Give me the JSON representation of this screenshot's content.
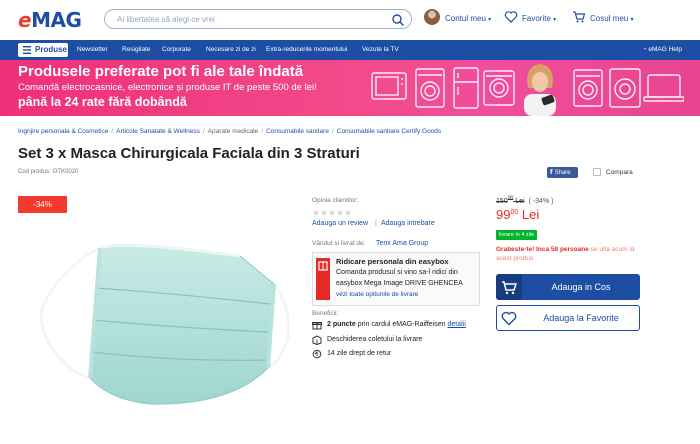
{
  "header": {
    "logo": {
      "e": "e",
      "mag": "MAG"
    },
    "search_placeholder": "Ai libertatea să alegi ce vrei",
    "account_label": "Contul meu",
    "favorites_label": "Favorite",
    "cart_label": "Cosul meu",
    "dropdown_glyph": "▾"
  },
  "nav": {
    "produse_label": "Produse",
    "items": [
      "Newsletter",
      "Resigilate",
      "Corporate",
      "Necesare zi de zi",
      "Extra-reducerile momentului",
      "Vezute la TV"
    ],
    "help_label": "eMAG Help"
  },
  "banner": {
    "line1": "Produsele preferate pot fi ale tale îndată",
    "line2": "Comandă electrocasnice, electronice și produse IT de peste 500 de lei!",
    "line3": "până la 24 rate fără dobândă"
  },
  "breadcrumb": [
    {
      "label": "Ingrijire personala & Cosmetice",
      "link": true
    },
    {
      "label": "Articole Sanatate & Wellness",
      "link": true
    },
    {
      "label": "Aparate medicale",
      "link": false
    },
    {
      "label": "Consumabile sanitare",
      "link": true
    },
    {
      "label": "Consumabile sanitare Certify Goods",
      "link": true
    }
  ],
  "breadcrumb_sep": "/",
  "product": {
    "title": "Set 3 x Masca Chirurgicala Faciala din 3 Straturi",
    "code_label": "Cod produs:",
    "code_value": "OTK0020",
    "discount_badge": "-34%",
    "share_label": "Share",
    "share_icon": "f",
    "compare_label": "Compara"
  },
  "reviews": {
    "opinion_label": "Opinia clientilor:",
    "rating": 0,
    "max_rating": 5,
    "add_review": "Adauga un review",
    "sep": "|",
    "add_question": "Adauga intrebare"
  },
  "seller": {
    "label": "Vândut și livrat de:",
    "name": "Tenx Ama Group"
  },
  "easybox": {
    "title": "Ridicare personala din easybox",
    "line1": "Comanda produsul si vino sa-l ridici din",
    "line2": "easybox Mega Image DRIVE GHENCEA",
    "link": "vezi toate optiunile de livrare"
  },
  "benefits": {
    "label": "Beneficii:",
    "points_bold": "2 puncte",
    "points_text": " prin cardul eMAG-Raiffeisen ",
    "points_link": "detalii",
    "open_package": "Deschiderea coletului la livrare",
    "return": "14 zile drept de retur"
  },
  "price": {
    "old": "150",
    "old_sup": "00",
    "old_currency": "Lei",
    "discount": "( -34% )",
    "new": "99",
    "new_sup": "00",
    "new_currency": "Lei",
    "stock": "livrare in 4 zile",
    "hurry_bold": "Grabeste-te! Inca 58 persoane",
    "hurry_text": " se uita acum la acest produs"
  },
  "buttons": {
    "add_to_cart": "Adauga in Cos",
    "add_to_fav": "Adauga la Favorite"
  },
  "colors": {
    "brand_blue": "#1d4ea3",
    "brand_red": "#f2392b",
    "banner_pink": "#ef2f7a",
    "stock_green": "#00b32d"
  }
}
